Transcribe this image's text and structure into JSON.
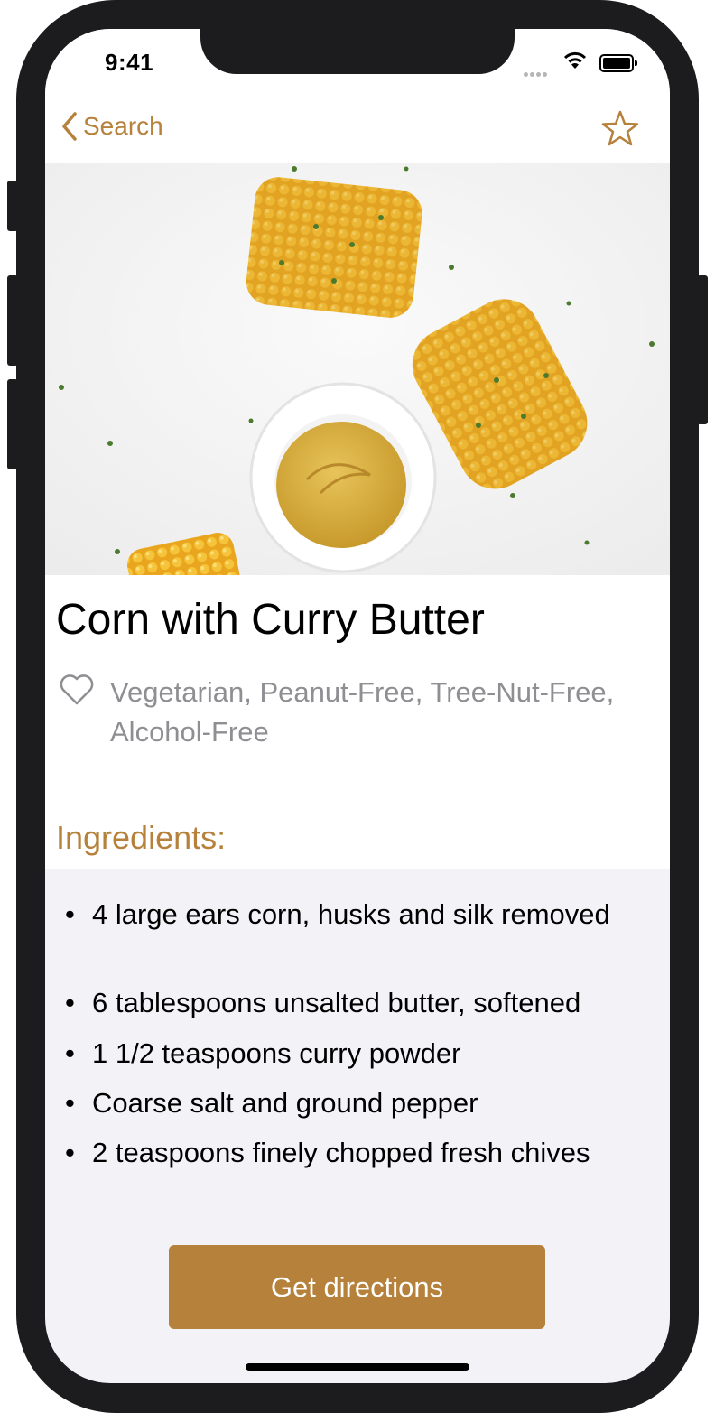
{
  "status": {
    "time": "9:41"
  },
  "nav": {
    "back_label": "Search",
    "accent": "#b5813b"
  },
  "recipe": {
    "title": "Corn with Curry Butter",
    "tags": "Vegetarian, Peanut-Free, Tree-Nut-Free, Alcohol-Free",
    "ingredients_heading": "Ingredients:",
    "ingredients": [
      "4 large ears corn, husks and silk removed",
      "6 tablespoons unsalted butter, softened",
      "1 1/2 teaspoons curry powder",
      "Coarse salt and ground pepper",
      "2 teaspoons finely chopped fresh chives"
    ]
  },
  "actions": {
    "directions_label": "Get directions"
  }
}
